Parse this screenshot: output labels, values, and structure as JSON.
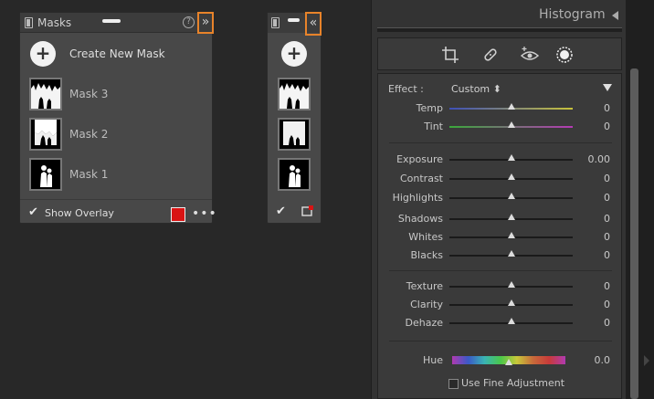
{
  "masks_panel": {
    "title": "Masks",
    "help_glyph": "?",
    "collapse_glyph": "»",
    "create_label": "Create New Mask",
    "add_glyph": "+",
    "masks": [
      {
        "label": "Mask 3"
      },
      {
        "label": "Mask 2"
      },
      {
        "label": "Mask 1"
      }
    ],
    "show_overlay_label": "Show Overlay",
    "overlay_checked": true,
    "overlay_color": "#d91414",
    "more_glyph": "•••"
  },
  "mini_panel": {
    "expand_glyph": "«",
    "add_glyph": "+"
  },
  "develop_panel": {
    "histogram_title": "Histogram",
    "effect_label": "Effect :",
    "effect_value": "Custom ⬍",
    "sliders": {
      "temp": {
        "label": "Temp",
        "value": "0",
        "level": 0.5
      },
      "tint": {
        "label": "Tint",
        "value": "0",
        "level": 0.5
      },
      "exposure": {
        "label": "Exposure",
        "value": "0.00",
        "level": 0.5
      },
      "contrast": {
        "label": "Contrast",
        "value": "0",
        "level": 0.5
      },
      "highlights": {
        "label": "Highlights",
        "value": "0",
        "level": 0.5
      },
      "shadows": {
        "label": "Shadows",
        "value": "0",
        "level": 0.5
      },
      "whites": {
        "label": "Whites",
        "value": "0",
        "level": 0.5
      },
      "blacks": {
        "label": "Blacks",
        "value": "0",
        "level": 0.5
      },
      "texture": {
        "label": "Texture",
        "value": "0",
        "level": 0.5
      },
      "clarity": {
        "label": "Clarity",
        "value": "0",
        "level": 0.5
      },
      "dehaze": {
        "label": "Dehaze",
        "value": "0",
        "level": 0.5
      },
      "hue": {
        "label": "Hue",
        "value": "0.0",
        "level": 0.5
      }
    },
    "fine_adjustment_label": "Use Fine Adjustment",
    "fine_adjustment_checked": false,
    "colors": {
      "temp_start": "#3d4fb8",
      "temp_end": "#c8c23a",
      "tint_start": "#3aa83a",
      "tint_end": "#b43ab4",
      "accent": "#e8832a"
    },
    "tool_icons": [
      "crop-icon",
      "healing-icon",
      "red-eye-icon",
      "masking-icon"
    ]
  }
}
